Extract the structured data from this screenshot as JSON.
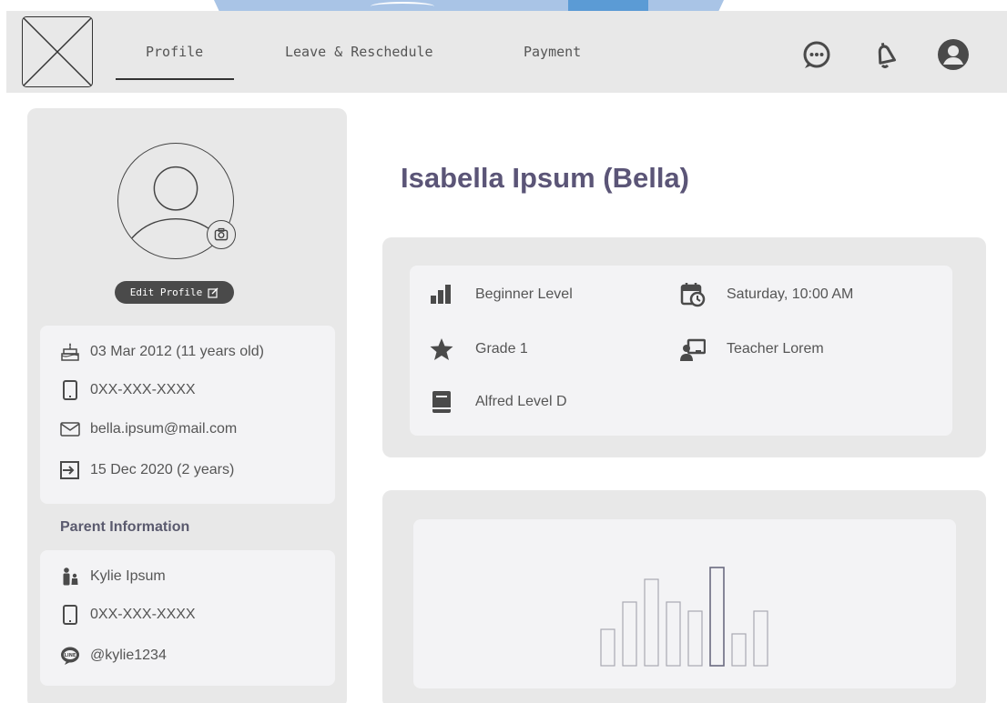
{
  "header": {
    "tabs": [
      {
        "label": "Profile",
        "active": true
      },
      {
        "label": "Leave & Reschedule",
        "active": false
      },
      {
        "label": "Payment",
        "active": false
      }
    ],
    "icons": [
      "chat-icon",
      "bell-icon",
      "user-circle-icon"
    ]
  },
  "profile": {
    "edit_label": "Edit Profile",
    "birthday": "03 Mar 2012 (11 years old)",
    "phone": "0XX-XXX-XXXX",
    "email": "bella.ipsum@mail.com",
    "joined": "15 Dec 2020 (2 years)"
  },
  "parent": {
    "section_title": "Parent Information",
    "name": "Kylie Ipsum",
    "phone": "0XX-XXX-XXXX",
    "line_id": "@kylie1234"
  },
  "student": {
    "name": "Isabella Ipsum (Bella)"
  },
  "details": {
    "level": "Beginner Level",
    "grade": "Grade 1",
    "book": "Alfred Level D",
    "schedule": "Saturday, 10:00 AM",
    "teacher": "Teacher Lorem"
  },
  "chart_data": {
    "type": "bar",
    "categories": [
      "",
      "",
      "",
      "",
      "",
      "",
      "",
      ""
    ],
    "values": [
      40,
      70,
      95,
      70,
      60,
      108,
      35,
      60
    ],
    "highlight_index": 5
  },
  "colors": {
    "accent_text": "#5b5577",
    "panel_bg": "#e8e8e8",
    "card_bg": "#f3f3f5",
    "icon_dark": "#4a4a4a"
  }
}
